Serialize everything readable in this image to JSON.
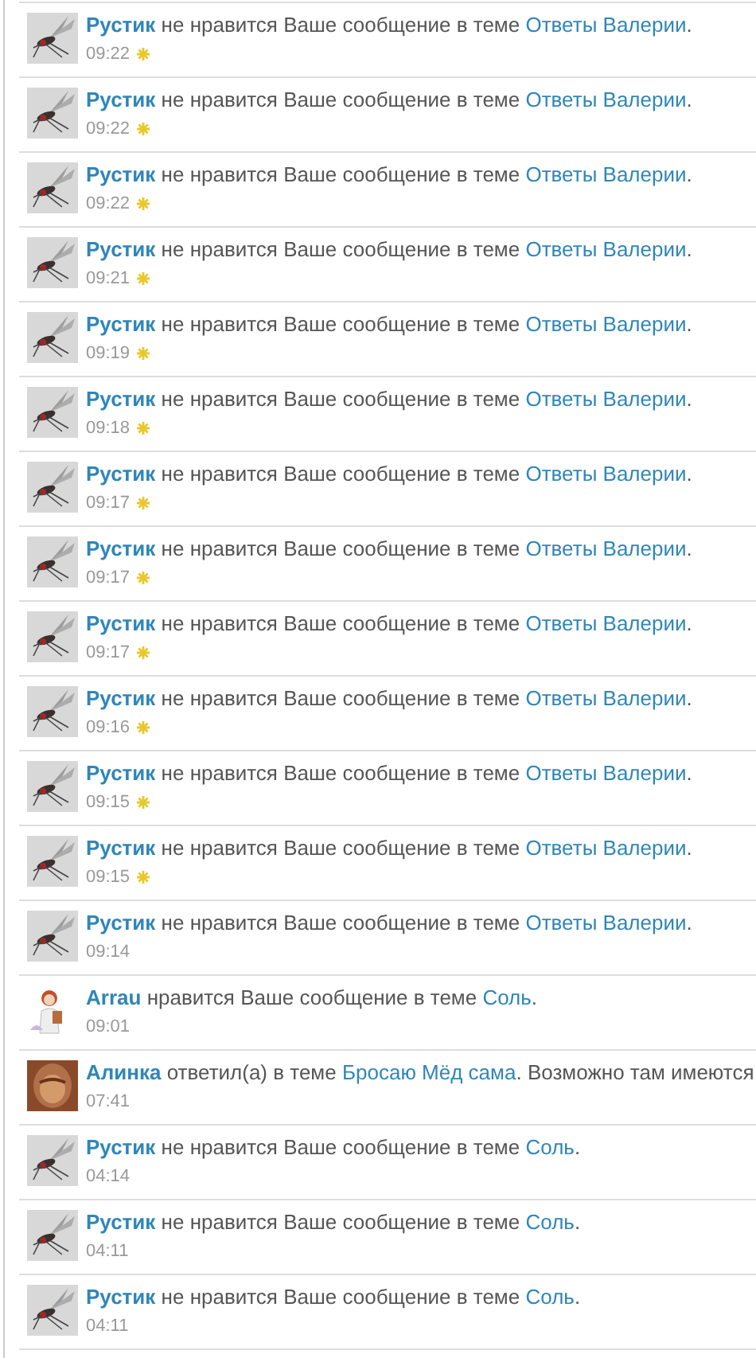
{
  "notifications": [
    {
      "avatar": {
        "kind": "insect"
      },
      "user": "Рустик",
      "action": "не нравится Ваше сообщение в теме",
      "topic": "Ответы Валерии",
      "end": ".",
      "time": "09:22",
      "unread": true
    },
    {
      "avatar": {
        "kind": "insect"
      },
      "user": "Рустик",
      "action": "не нравится Ваше сообщение в теме",
      "topic": "Ответы Валерии",
      "end": ".",
      "time": "09:22",
      "unread": true
    },
    {
      "avatar": {
        "kind": "insect"
      },
      "user": "Рустик",
      "action": "не нравится Ваше сообщение в теме",
      "topic": "Ответы Валерии",
      "end": ".",
      "time": "09:22",
      "unread": true
    },
    {
      "avatar": {
        "kind": "insect"
      },
      "user": "Рустик",
      "action": "не нравится Ваше сообщение в теме",
      "topic": "Ответы Валерии",
      "end": ".",
      "time": "09:21",
      "unread": true
    },
    {
      "avatar": {
        "kind": "insect"
      },
      "user": "Рустик",
      "action": "не нравится Ваше сообщение в теме",
      "topic": "Ответы Валерии",
      "end": ".",
      "time": "09:19",
      "unread": true
    },
    {
      "avatar": {
        "kind": "insect"
      },
      "user": "Рустик",
      "action": "не нравится Ваше сообщение в теме",
      "topic": "Ответы Валерии",
      "end": ".",
      "time": "09:18",
      "unread": true
    },
    {
      "avatar": {
        "kind": "insect"
      },
      "user": "Рустик",
      "action": "не нравится Ваше сообщение в теме",
      "topic": "Ответы Валерии",
      "end": ".",
      "time": "09:17",
      "unread": true
    },
    {
      "avatar": {
        "kind": "insect"
      },
      "user": "Рустик",
      "action": "не нравится Ваше сообщение в теме",
      "topic": "Ответы Валерии",
      "end": ".",
      "time": "09:17",
      "unread": true
    },
    {
      "avatar": {
        "kind": "insect"
      },
      "user": "Рустик",
      "action": "не нравится Ваше сообщение в теме",
      "topic": "Ответы Валерии",
      "end": ".",
      "time": "09:17",
      "unread": true
    },
    {
      "avatar": {
        "kind": "insect"
      },
      "user": "Рустик",
      "action": "не нравится Ваше сообщение в теме",
      "topic": "Ответы Валерии",
      "end": ".",
      "time": "09:16",
      "unread": true
    },
    {
      "avatar": {
        "kind": "insect"
      },
      "user": "Рустик",
      "action": "не нравится Ваше сообщение в теме",
      "topic": "Ответы Валерии",
      "end": ".",
      "time": "09:15",
      "unread": true
    },
    {
      "avatar": {
        "kind": "insect"
      },
      "user": "Рустик",
      "action": "не нравится Ваше сообщение в теме",
      "topic": "Ответы Валерии",
      "end": ".",
      "time": "09:15",
      "unread": true
    },
    {
      "avatar": {
        "kind": "insect"
      },
      "user": "Рустик",
      "action": "не нравится Ваше сообщение в теме",
      "topic": "Ответы Валерии",
      "end": ".",
      "time": "09:14",
      "unread": false
    },
    {
      "avatar": {
        "kind": "figure"
      },
      "user": "Arrau",
      "action": "нравится Ваше сообщение в теме",
      "topic": "Соль",
      "end": ".",
      "time": "09:01",
      "unread": false
    },
    {
      "avatar": {
        "kind": "portrait"
      },
      "user": "Алинка",
      "action": "ответил(а) в теме",
      "topic": "Бросаю Мёд сама",
      "end": ".",
      "tail": "Возможно там имеются",
      "time": "07:41",
      "unread": false
    },
    {
      "avatar": {
        "kind": "insect"
      },
      "user": "Рустик",
      "action": "не нравится Ваше сообщение в теме",
      "topic": "Соль",
      "end": ".",
      "time": "04:14",
      "unread": false
    },
    {
      "avatar": {
        "kind": "insect"
      },
      "user": "Рустик",
      "action": "не нравится Ваше сообщение в теме",
      "topic": "Соль",
      "end": ".",
      "time": "04:11",
      "unread": false
    },
    {
      "avatar": {
        "kind": "insect"
      },
      "user": "Рустик",
      "action": "не нравится Ваше сообщение в теме",
      "topic": "Соль",
      "end": ".",
      "time": "04:11",
      "unread": false
    }
  ]
}
